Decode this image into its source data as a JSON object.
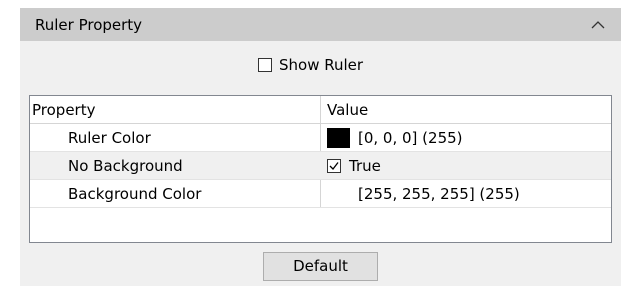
{
  "panel": {
    "title": "Ruler Property",
    "collapse_icon": "chevron-up-icon"
  },
  "show_ruler": {
    "label": "Show Ruler",
    "checked": false
  },
  "grid": {
    "headers": {
      "property": "Property",
      "value": "Value"
    },
    "rows": [
      {
        "property": "Ruler Color",
        "value": "[0, 0, 0] (255)",
        "swatch_color": "#000000"
      },
      {
        "property": "No Background",
        "value": "True",
        "checked": true
      },
      {
        "property": "Background Color",
        "value": "[255, 255, 255] (255)"
      }
    ]
  },
  "buttons": {
    "default_label": "Default"
  }
}
